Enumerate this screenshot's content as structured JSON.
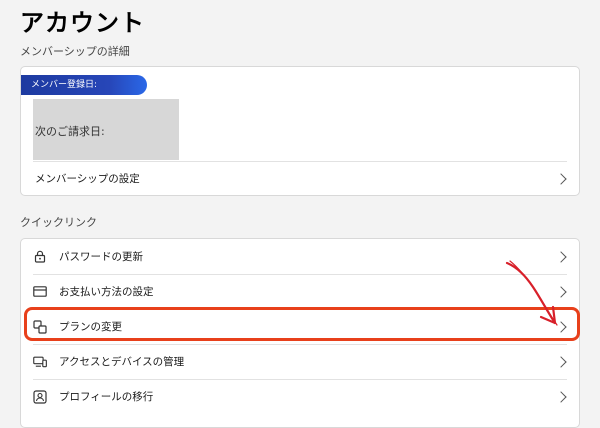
{
  "page": {
    "title": "アカウント"
  },
  "membership": {
    "section_label": "メンバーシップの詳細",
    "badge_label": "メンバー登録日:",
    "billing_label": "次のご請求日:",
    "settings_label": "メンバーシップの設定"
  },
  "quick_links": {
    "section_label": "クイックリンク",
    "items": [
      {
        "label": "パスワードの更新",
        "icon": "lock-icon"
      },
      {
        "label": "お支払い方法の設定",
        "icon": "credit-card-icon"
      },
      {
        "label": "プランの変更",
        "icon": "plan-change-icon"
      },
      {
        "label": "アクセスとデバイスの管理",
        "icon": "devices-icon"
      },
      {
        "label": "プロフィールの移行",
        "icon": "profile-transfer-icon"
      }
    ]
  },
  "colors": {
    "highlight": "#e8401b",
    "badge": "#2746b8"
  }
}
